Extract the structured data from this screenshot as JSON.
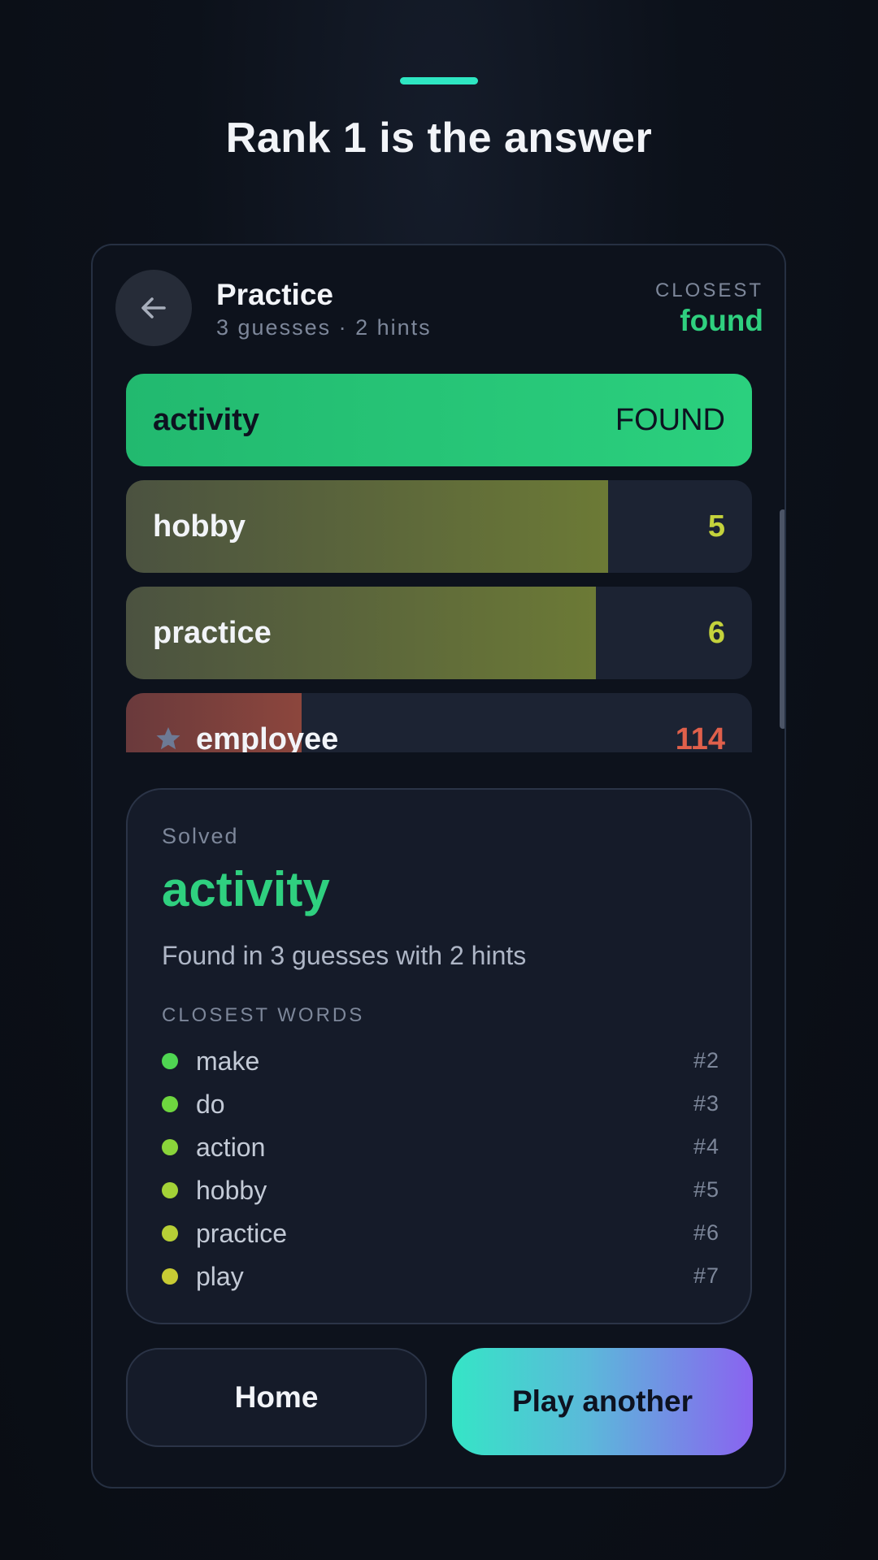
{
  "headline": "Rank 1 is the answer",
  "colors": {
    "accent_teal": "#2ee6c2",
    "found_green": "#2fd07f",
    "warm_yellow": "#c4d23c",
    "cold_red": "#e0604b"
  },
  "header": {
    "back_icon": "arrow-left-icon",
    "title": "Practice",
    "subtitle": "3 guesses · 2 hints",
    "closest_label": "CLOSEST",
    "closest_value": "found"
  },
  "guesses": [
    {
      "word": "activity",
      "rank": "FOUND",
      "closeness": 1.0,
      "status": "found",
      "hint": false
    },
    {
      "word": "hobby",
      "rank": "5",
      "closeness": 0.77,
      "status": "warm",
      "hint": false
    },
    {
      "word": "practice",
      "rank": "6",
      "closeness": 0.75,
      "status": "warm",
      "hint": false
    },
    {
      "word": "employee",
      "rank": "114",
      "closeness": 0.28,
      "status": "cold",
      "hint": true
    }
  ],
  "solved": {
    "label": "Solved",
    "word": "activity",
    "summary": "Found in 3 guesses with 2 hints",
    "closest_words_label": "CLOSEST WORDS",
    "closest_words": [
      {
        "word": "make",
        "rank": "#2",
        "dot_color": "#4fd652"
      },
      {
        "word": "do",
        "rank": "#3",
        "dot_color": "#6ed63f"
      },
      {
        "word": "action",
        "rank": "#4",
        "dot_color": "#8ad43a"
      },
      {
        "word": "hobby",
        "rank": "#5",
        "dot_color": "#a3d237"
      },
      {
        "word": "practice",
        "rank": "#6",
        "dot_color": "#b7cf36"
      },
      {
        "word": "play",
        "rank": "#7",
        "dot_color": "#c8cb34"
      }
    ]
  },
  "buttons": {
    "home": "Home",
    "play_another": "Play another"
  }
}
